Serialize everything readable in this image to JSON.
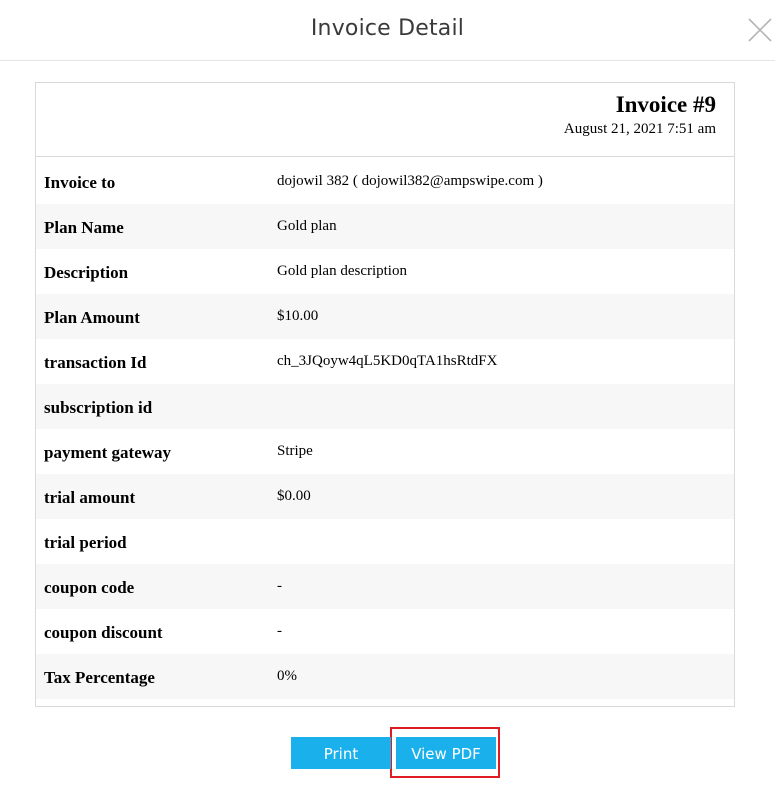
{
  "modal": {
    "title": "Invoice Detail",
    "close_icon": "close-icon"
  },
  "invoice": {
    "number": "Invoice #9",
    "date": "August 21, 2021 7:51 am"
  },
  "rows": [
    {
      "label": "Invoice to",
      "value": "dojowil 382 ( dojowil382@ampswipe.com )"
    },
    {
      "label": "Plan Name",
      "value": "Gold plan"
    },
    {
      "label": "Description",
      "value": "Gold plan description"
    },
    {
      "label": "Plan Amount",
      "value": "$10.00"
    },
    {
      "label": "transaction Id",
      "value": "ch_3JQoyw4qL5KD0qTA1hsRtdFX"
    },
    {
      "label": "subscription id",
      "value": ""
    },
    {
      "label": "payment gateway",
      "value": "Stripe"
    },
    {
      "label": "trial amount",
      "value": "$0.00"
    },
    {
      "label": "trial period",
      "value": ""
    },
    {
      "label": "coupon code",
      "value": "-"
    },
    {
      "label": "coupon discount",
      "value": "-"
    },
    {
      "label": "Tax Percentage",
      "value": "0%"
    }
  ],
  "actions": {
    "print_label": "Print",
    "view_pdf_label": "View PDF"
  },
  "colors": {
    "button": "#1ab0ec",
    "highlight": "#e01b24",
    "alt_row": "#f7f7f7"
  }
}
